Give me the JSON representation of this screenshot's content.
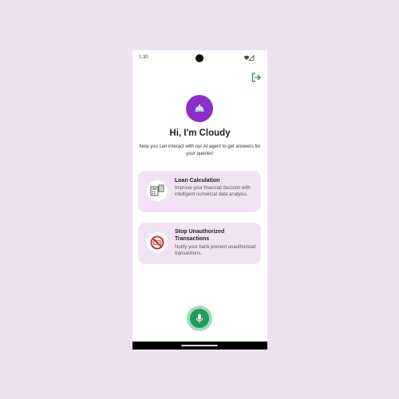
{
  "status_bar": {
    "time": "1:30"
  },
  "header": {
    "logout_icon": "logout-icon"
  },
  "avatar": {
    "icon": "cloud-bot-icon",
    "color": "#8b2fc9"
  },
  "greeting": "Hi, I'm Cloudy",
  "subtitle": "Now you can interact with our AI agent to get answers for your queries!",
  "cards": [
    {
      "title": "Loan Calculation",
      "description": "Improve your financial decision with intelligent numerical data analysis.",
      "icon": "calculator-icon"
    },
    {
      "title": "Stop Unauthorized Transactions",
      "description": "Notify your bank prevent unauthorized transactions.",
      "icon": "no-fraud-icon"
    }
  ],
  "mic": {
    "icon": "microphone-icon",
    "color": "#1f9a5c"
  },
  "colors": {
    "background": "#eee1f2",
    "card": "#f2e3f4",
    "accent_green": "#1f9a5c"
  }
}
